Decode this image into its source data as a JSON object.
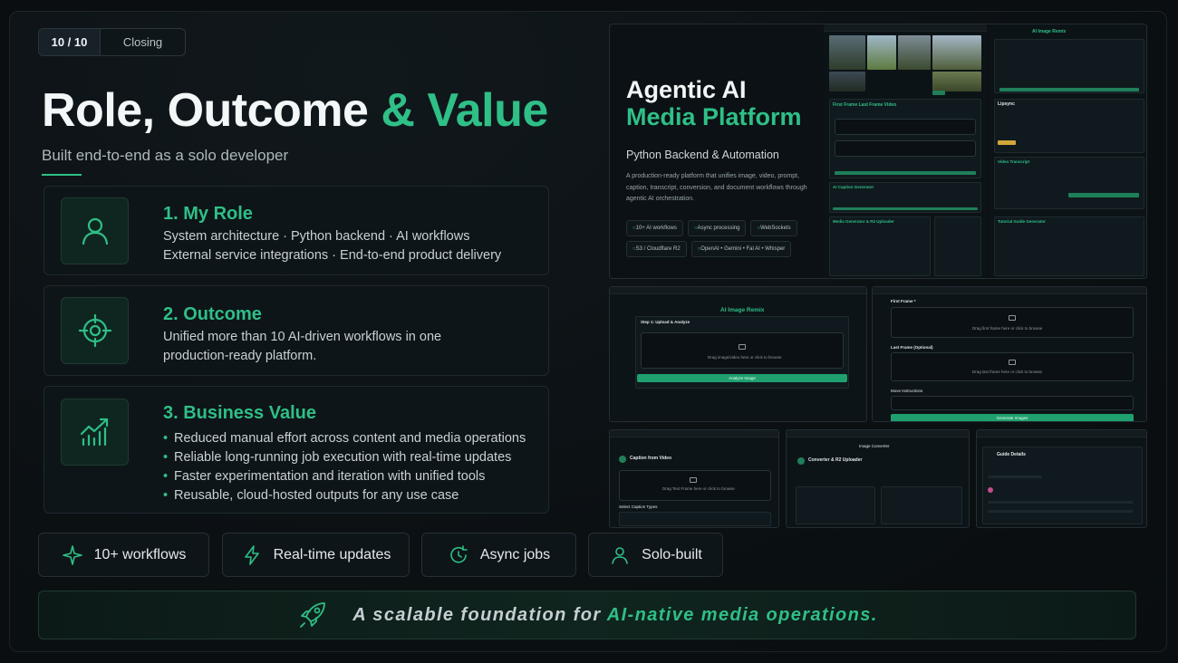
{
  "badge": {
    "number": "10 / 10",
    "label": "Closing"
  },
  "title": {
    "main": "Role, Outcome ",
    "accent": "& Value"
  },
  "subtitle": "Built end-to-end as a solo developer",
  "cards": [
    {
      "title": "1. My Role",
      "icon": "user-icon",
      "lines": [
        "System architecture · Python backend · AI workflows",
        "External service integrations · End-to-end product delivery"
      ]
    },
    {
      "title": "2. Outcome",
      "icon": "target-icon",
      "lines": [
        "Unified more than 10 AI-driven workflows in one",
        "production-ready platform."
      ]
    },
    {
      "title": "3. Business Value",
      "icon": "growth-chart-icon",
      "bullets": [
        "Reduced manual effort across content and media operations",
        "Reliable long-running job execution with real-time updates",
        "Faster experimentation and iteration with unified tools",
        "Reusable, cloud-hosted outputs for any use case"
      ]
    }
  ],
  "chips": [
    {
      "label": "10+ workflows",
      "icon": "sparkle-icon"
    },
    {
      "label": "Real-time updates",
      "icon": "lightning-icon"
    },
    {
      "label": "Async jobs",
      "icon": "refresh-clock-icon"
    },
    {
      "label": "Solo-built",
      "icon": "user-icon"
    }
  ],
  "banner": {
    "prefix": "A scalable foundation for ",
    "highlight": "AI-native media operations.",
    "icon": "rocket-icon"
  },
  "hero": {
    "title_line1": "Agentic AI",
    "title_line2": "Media Platform",
    "subtitle": "Python Backend & Automation",
    "description": "A production-ready platform that unifies image, video, prompt, caption, transcript, conversion, and document workflows through agentic AI orchestration.",
    "tags": [
      "10+ AI workflows",
      "Async processing",
      "WebSockets",
      "S3 / Cloudflare R2",
      "OpenAI • Gemini • Fal AI • Whisper"
    ]
  },
  "mocks": {
    "remix": {
      "title": "AI Image Remix",
      "step": "Step 1: Upload & Analyze",
      "drop": "Drag image/video here or click to browse",
      "button": "Analyze Image"
    },
    "frames": {
      "first": "First Frame *",
      "first_drop": "Drag first frame here or click to browse",
      "last": "Last Frame (Optional)",
      "last_drop": "Drag last frame here or click to browse",
      "instructions": "Move Instructions",
      "button": "Generate Images"
    },
    "caption": {
      "title": "Caption from Video",
      "drop": "Drag Text Frame here or click to browse",
      "types": "Select Caption Types"
    },
    "converter": {
      "header": "Image Converter",
      "title": "Converter & R2 Uploader"
    },
    "guide": {
      "title": "Guide Details"
    },
    "hero_right": {
      "title": "AI Image Remix",
      "lipsync": "Lipsync",
      "video": "Video Transcript",
      "tutorial": "Tutorial Guide Generator"
    },
    "hero_left": {
      "title": "First Frame Last Frame Video",
      "prompt": "AI Caption Generator",
      "gemini": "Media Generator & R2 Uploader"
    }
  },
  "colors": {
    "accent": "#2fbf87",
    "background": "#0a0e11",
    "card": "#0e1518"
  }
}
